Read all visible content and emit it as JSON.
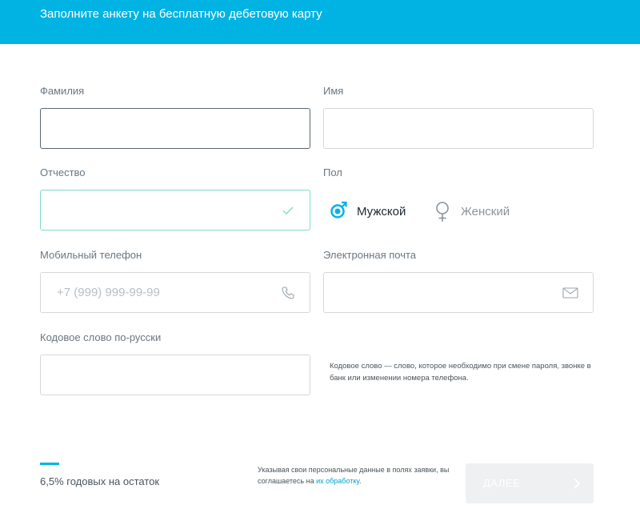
{
  "header": {
    "title": "Заполните анкету на бесплатную дебетовую карту"
  },
  "form": {
    "surname": {
      "label": "Фамилия",
      "value": ""
    },
    "name": {
      "label": "Имя",
      "value": ""
    },
    "patronymic": {
      "label": "Отчество",
      "value": ""
    },
    "gender": {
      "label": "Пол",
      "options": [
        {
          "label": "Мужской",
          "icon": "male-symbol-icon",
          "selected": true
        },
        {
          "label": "Женский",
          "icon": "female-symbol-icon",
          "selected": false
        }
      ]
    },
    "phone": {
      "label": "Мобильный телефон",
      "placeholder": "+7 (999) 999-99-99",
      "icon": "phone-icon"
    },
    "email": {
      "label": "Электронная почта",
      "value": "",
      "icon": "envelope-icon"
    },
    "codeword": {
      "label": "Кодовое слово по-русски",
      "value": "",
      "hint": "Кодовое слово — слово, которое необходимо при смене пароля, звонке в банк или изменении номера телефона."
    }
  },
  "footer": {
    "rate": "6,5% годовых на остаток",
    "consent_text": "Указывая свои персональные данные в полях заявки, вы соглашаетесь на",
    "consent_link": "их обработку",
    "consent_end": ".",
    "next_label": "ДАЛЕЕ"
  },
  "colors": {
    "accent": "#00b3e3",
    "valid_border": "#7fdbc9",
    "link": "#00a0cf"
  }
}
